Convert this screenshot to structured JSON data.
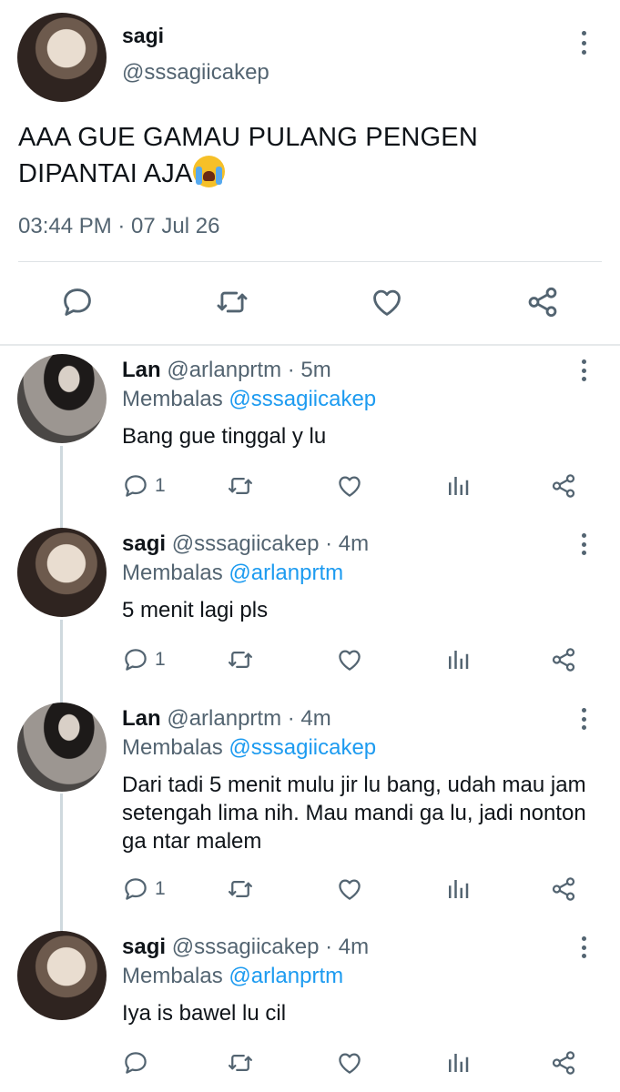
{
  "main_tweet": {
    "name": "sagi",
    "handle": "@sssagiicakep",
    "text_line1": "AAA GUE GAMAU PULANG PENGEN",
    "text_line2": "DIPANTAI AJA",
    "emoji": "loudly-crying-face",
    "timestamp": "03:44 PM · 07 Jul 26",
    "actions": [
      "reply-icon",
      "retweet-icon",
      "like-icon",
      "share-icon"
    ]
  },
  "replies": [
    {
      "name": "Lan",
      "handle": "@arlanprtm · 5m",
      "replying_prefix": "Membalas",
      "replying_to": "@sssagiicakep",
      "text": "Bang gue tinggal y lu",
      "reply_count": "1"
    },
    {
      "name": "sagi",
      "handle": "@sssagiicakep · 4m",
      "replying_prefix": "Membalas",
      "replying_to": "@arlanprtm",
      "text": "5 menit lagi pls",
      "reply_count": "1"
    },
    {
      "name": "Lan",
      "handle": "@arlanprtm · 4m",
      "replying_prefix": "Membalas",
      "replying_to": "@sssagiicakep",
      "text": "Dari tadi 5 menit mulu jir lu bang, udah mau jam setengah lima nih. Mau mandi ga lu, jadi nonton ga ntar malem",
      "reply_count": "1"
    },
    {
      "name": "sagi",
      "handle": "@sssagiicakep · 4m",
      "replying_prefix": "Membalas",
      "replying_to": "@arlanprtm",
      "text": "Iya is bawel lu cil",
      "reply_count": ""
    }
  ],
  "colors": {
    "text": "#0f1419",
    "secondary": "#536471",
    "accent": "#1d9bf0",
    "divider": "#dfe3e6"
  }
}
